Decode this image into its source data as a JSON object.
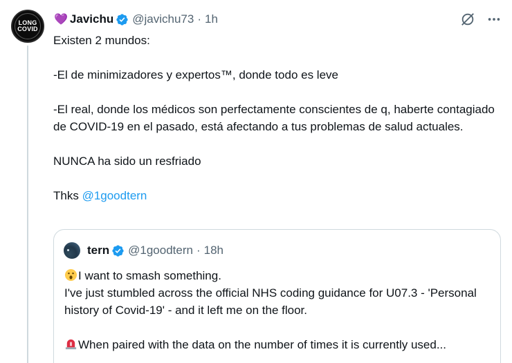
{
  "author": {
    "avatar_text_line1": "LONG",
    "avatar_text_line2": "COVID",
    "heart": "💜",
    "name": "Javichu",
    "handle": "@javichu73",
    "separator": "·",
    "time": "1h"
  },
  "tweet": {
    "lines": [
      "Existen 2 mundos:",
      "-El de minimizadores y expertos™, donde todo es leve",
      "-El real, donde los médicos son perfectamente conscientes de q, haberte contagiado de COVID-19 en el pasado, está afectando a tus problemas de salud actuales.",
      "NUNCA ha sido un resfriado"
    ],
    "thanks_prefix": "Thks ",
    "mention": "@1goodtern"
  },
  "quoted": {
    "name": "tern",
    "handle": "@1goodtern",
    "separator": "·",
    "time": "18h",
    "line1": "I want to smash something.",
    "line2": "I've just stumbled across the official NHS coding guidance for U07.3 - 'Personal history of Covid-19' - and it left me on the floor.",
    "line3": "When paired with the data on the number of times it is currently used..."
  },
  "icons": {
    "verified": "verified-badge-icon",
    "grok": "grok-icon",
    "more": "more-options-icon"
  },
  "colors": {
    "link": "#1d9bf0",
    "verified": "#1d9bf0",
    "secondary_text": "#536471",
    "border": "#cfd9de"
  }
}
